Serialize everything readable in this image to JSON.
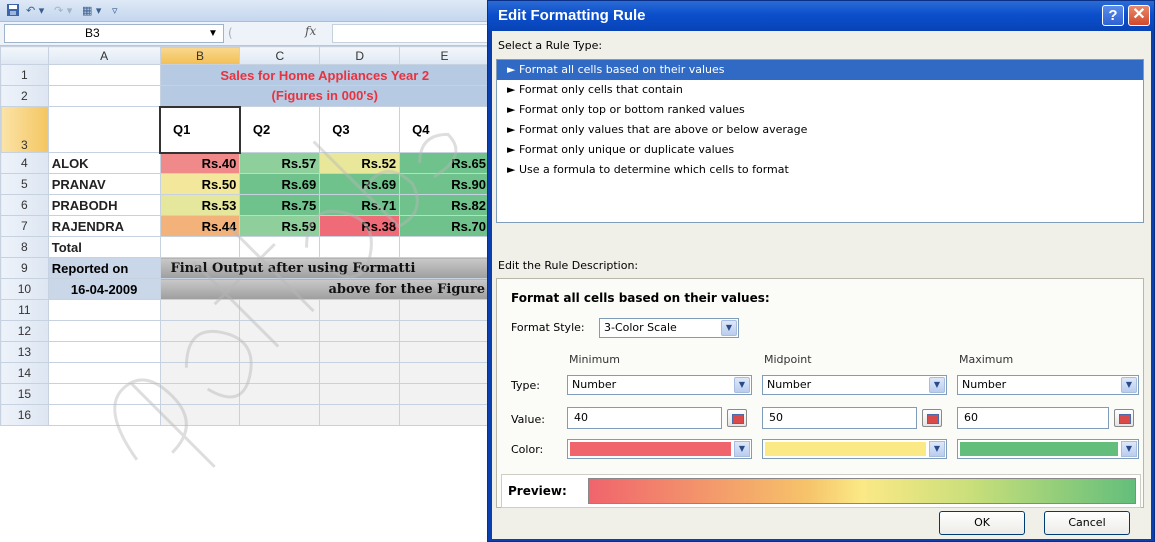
{
  "excel": {
    "namebox": "B3",
    "fx_label": "fx",
    "column_headers": [
      "A",
      "B",
      "C",
      "D",
      "E"
    ],
    "row_numbers": [
      "1",
      "2",
      "3",
      "4",
      "5",
      "6",
      "7",
      "8",
      "9",
      "10",
      "11",
      "12",
      "13",
      "14",
      "15",
      "16"
    ],
    "title": "Sales for Home Appliances Year 2",
    "subtitle": "(Figures in 000's)",
    "quarters": [
      "Q1",
      "Q2",
      "Q3",
      "Q4"
    ],
    "rows": [
      {
        "name": "ALOK",
        "values": [
          "Rs.40",
          "Rs.57",
          "Rs.52",
          "Rs.65"
        ]
      },
      {
        "name": "PRANAV",
        "values": [
          "Rs.50",
          "Rs.69",
          "Rs.69",
          "Rs.90"
        ]
      },
      {
        "name": "PRABODH",
        "values": [
          "Rs.53",
          "Rs.75",
          "Rs.71",
          "Rs.82"
        ]
      },
      {
        "name": "RAJENDRA",
        "values": [
          "Rs.44",
          "Rs.59",
          "Rs.38",
          "Rs.70"
        ]
      }
    ],
    "total_label": "Total",
    "reported_on_label": "Reported on",
    "reported_date": "16-04-2009",
    "footer_line1": "Final Output after using Formatti",
    "footer_line2": "above for thee Figure",
    "cell_colors": {
      "red": "#f08a8a",
      "orange": "#f3b27a",
      "yellow": "#f1e79a",
      "lightgreen": "#b7dc9a",
      "green": "#80c898"
    }
  },
  "dialog": {
    "title": "Edit Formatting Rule",
    "help_label": "?",
    "close_label": "✕",
    "select_rule_type_label": "Select a Rule Type:",
    "rule_types": [
      "► Format all cells based on their values",
      "► Format only cells that contain",
      "► Format only top or bottom ranked values",
      "► Format only values that are above or below average",
      "► Format only unique or duplicate values",
      "► Use a formula to determine which cells to format"
    ],
    "selected_rule_index": 0,
    "edit_rule_description_label": "Edit the Rule Description:",
    "description_heading": "Format all cells based on their values:",
    "format_style_label": "Format Style:",
    "format_style_value": "3-Color Scale",
    "columns": [
      "Minimum",
      "Midpoint",
      "Maximum"
    ],
    "type_label": "Type:",
    "value_label": "Value:",
    "color_label": "Color:",
    "types": [
      "Number",
      "Number",
      "Number"
    ],
    "values": [
      "40",
      "50",
      "60"
    ],
    "colors": [
      "#f0646c",
      "#fbe986",
      "#63be7b"
    ],
    "preview_label": "Preview:",
    "ok_label": "OK",
    "cancel_label": "Cancel"
  }
}
